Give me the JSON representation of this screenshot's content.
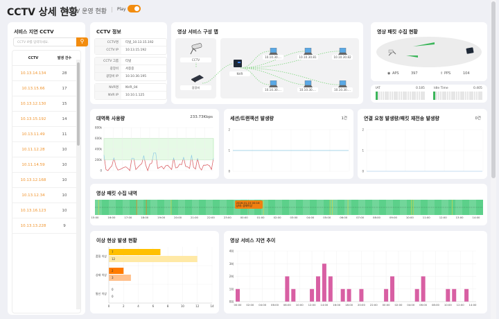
{
  "header": {
    "title": "CCTV 상세 현황",
    "subtitle": "CCTV 운영 현황",
    "play_label": "Play",
    "play_on": true
  },
  "accent": "#f28c0f",
  "delay_list": {
    "title": "서비스 지연 CCTV",
    "search_placeholder": "CCTV IP를 입력하세요.",
    "search_icon": "search-icon",
    "columns": [
      "CCTV",
      "발생 건수"
    ],
    "rows": [
      [
        "10.13.14.134",
        "28"
      ],
      [
        "10.13.15.66",
        "17"
      ],
      [
        "10.13.12.130",
        "15"
      ],
      [
        "10.13.15.192",
        "14"
      ],
      [
        "10.13.11.49",
        "11"
      ],
      [
        "10.11.12.28",
        "10"
      ],
      [
        "10.11.14.59",
        "10"
      ],
      [
        "10.13.12.168",
        "10"
      ],
      [
        "10.13.12.34",
        "10"
      ],
      [
        "10.13.16.123",
        "10"
      ],
      [
        "10.13.13.228",
        "9"
      ]
    ]
  },
  "cctv_info": {
    "title": "CCTV 정보",
    "groups": [
      [
        [
          "CCTV명",
          "티넷_10.13.15.192"
        ],
        [
          "CCTV IP",
          "10.13.15.192"
        ]
      ],
      [
        [
          "CCTV 그룹",
          "티넷"
        ],
        [
          "광장비",
          "서종중"
        ],
        [
          "광장비 IP",
          "10.10.30.195"
        ]
      ],
      [
        [
          "NVR명",
          "NVR_04"
        ],
        [
          "NVR IP",
          "10.10.1.125"
        ]
      ]
    ]
  },
  "topology": {
    "title": "영상 서비스 구성 맵",
    "cctv": "CCTV",
    "optical": "광장비",
    "nvr": "NVR",
    "clients": [
      "10.10.30....",
      "10.10.30.81",
      "10.10.30.82",
      "10.10.30....",
      "10.10.30....",
      "10.10.30...."
    ]
  },
  "packet": {
    "title": "영상 패킷 수집 현황",
    "aps_label": "APS",
    "aps": "397",
    "pps_label": "PPS",
    "pps": "104",
    "iat_label": "IAT",
    "iat": "0.185",
    "iat_level": 0.05,
    "idle_label": "Idle Time",
    "idle": "0.405",
    "idle_level": 0.05
  },
  "bandwidth": {
    "title": "대역폭 사용량",
    "value": "233.73Kbps",
    "yticks": [
      "0",
      "200k",
      "400k",
      "600k",
      "800k"
    ],
    "ylim": [
      0,
      800
    ],
    "band": [
      200,
      600
    ],
    "values_k": [
      290,
      20,
      0,
      50,
      90,
      240,
      80,
      10,
      20,
      40,
      60,
      70,
      40,
      0,
      230,
      230,
      20,
      60,
      100,
      130,
      280,
      100,
      0,
      120,
      140,
      330,
      330,
      40,
      60,
      80,
      30,
      90,
      100,
      60,
      20,
      240,
      50,
      60,
      120,
      110,
      250,
      80,
      70,
      40,
      290,
      60,
      30,
      230,
      60,
      10,
      100,
      100,
      110,
      90,
      20,
      230
    ]
  },
  "session": {
    "title": "세션/트랜잭션 발생량",
    "value": "1건",
    "yticks": [
      "0",
      "1",
      "2"
    ],
    "level": 1
  },
  "connection": {
    "title": "연결 요청 발생량/패킷 재전송 발생량",
    "value": "0건",
    "yticks": [
      "0",
      "1",
      "2"
    ],
    "level": 0
  },
  "timeline": {
    "title": "영상 패킷 수집 내역",
    "ticks": [
      "15:00",
      "16:00",
      "17:00",
      "18:00",
      "19:00",
      "20:00",
      "21:00",
      "22:00",
      "23:00",
      "00:00",
      "01:00",
      "02:00",
      "03:00",
      "04:00",
      "05:00",
      "06:00",
      "07:00",
      "08:00",
      "09:00",
      "10:00",
      "11:00",
      "12:00",
      "13:00",
      "14:00"
    ],
    "warn_marks": [
      "15:13",
      "19:36",
      "01:10",
      "05:11",
      "05:19",
      "06:16",
      "10:05",
      "10:12",
      "12:33"
    ],
    "error_marks": [
      "17:31",
      "18:06"
    ],
    "tooltip": {
      "time": "00:16",
      "line1": "2026.01.15 00:16",
      "line2": "상태: 상태이상"
    },
    "colors": {
      "ok": "#5cd08a",
      "warn": "#d8d84a",
      "error": "#f07a10"
    }
  },
  "anomaly": {
    "title": "이상 현상 발생 현황",
    "categories": [
      "품질 이상",
      "상태 이상",
      "통신 이상"
    ],
    "series": [
      [
        7,
        2,
        0
      ],
      [
        12,
        3,
        0
      ]
    ],
    "colors": [
      [
        "#ffc000",
        "#ffe9a6"
      ],
      [
        "#ff7b00",
        "#ffc08c"
      ],
      [
        "#ffc000",
        "#ffe9a6"
      ]
    ],
    "xticks": [
      "0",
      "2",
      "4",
      "6",
      "8",
      "10",
      "12",
      "14"
    ],
    "xlim": [
      0,
      14
    ]
  },
  "latency": {
    "title": "영상 서비스 지연 추이",
    "yticks": [
      "0회",
      "1회",
      "2회",
      "3회",
      "4회"
    ],
    "ylim": [
      0,
      4
    ],
    "color": "#d85fa3",
    "xticks": [
      "00:00",
      "02:00",
      "04:00",
      "06:00",
      "08:00",
      "10:00",
      "12:00",
      "14:00",
      "16:00",
      "18:00",
      "20:00",
      "22:00",
      "00:00",
      "02:00",
      "04:00",
      "06:00",
      "08:00",
      "10:00",
      "12:00",
      "14:00"
    ],
    "values": [
      1,
      0,
      0,
      0,
      0,
      0,
      0,
      0,
      2,
      1,
      0,
      0,
      1,
      2,
      3,
      2,
      0,
      1,
      1,
      0,
      1,
      0,
      0,
      0,
      1,
      2,
      0,
      0,
      0,
      1,
      2,
      0,
      0,
      0,
      1,
      1,
      0,
      1,
      0
    ]
  }
}
